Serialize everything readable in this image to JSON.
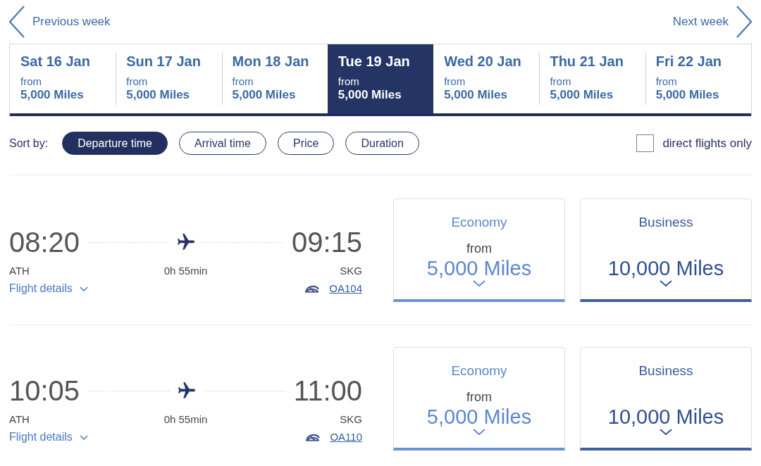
{
  "week_nav": {
    "previous": "Previous week",
    "next": "Next week"
  },
  "dates": [
    {
      "date": "Sat 16 Jan",
      "from": "from",
      "price": "5,000 Miles",
      "selected": false
    },
    {
      "date": "Sun 17 Jan",
      "from": "from",
      "price": "5,000 Miles",
      "selected": false
    },
    {
      "date": "Mon 18 Jan",
      "from": "from",
      "price": "5,000 Miles",
      "selected": false
    },
    {
      "date": "Tue 19 Jan",
      "from": "from",
      "price": "5,000 Miles",
      "selected": true
    },
    {
      "date": "Wed 20 Jan",
      "from": "from",
      "price": "5,000 Miles",
      "selected": false
    },
    {
      "date": "Thu 21 Jan",
      "from": "from",
      "price": "5,000 Miles",
      "selected": false
    },
    {
      "date": "Fri 22 Jan",
      "from": "from",
      "price": "5,000 Miles",
      "selected": false
    }
  ],
  "sort": {
    "label": "Sort by:",
    "options": [
      {
        "label": "Departure time",
        "selected": true
      },
      {
        "label": "Arrival time",
        "selected": false
      },
      {
        "label": "Price",
        "selected": false
      },
      {
        "label": "Duration",
        "selected": false
      }
    ]
  },
  "direct_only": {
    "label": "direct flights only",
    "checked": false
  },
  "flights": [
    {
      "departure_time": "08:20",
      "arrival_time": "09:15",
      "origin": "ATH",
      "destination": "SKG",
      "duration": "0h 55min",
      "details_link": "Flight details",
      "flight_number": "OA104",
      "fares": [
        {
          "kind": "economy",
          "cabin": "Economy",
          "from": "from",
          "price": "5,000 Miles"
        },
        {
          "kind": "business",
          "cabin": "Business",
          "price": "10,000 Miles"
        }
      ]
    },
    {
      "departure_time": "10:05",
      "arrival_time": "11:00",
      "origin": "ATH",
      "destination": "SKG",
      "duration": "0h 55min",
      "details_link": "Flight details",
      "flight_number": "OA110",
      "fares": [
        {
          "kind": "economy",
          "cabin": "Economy",
          "from": "from",
          "price": "5,000 Miles"
        },
        {
          "kind": "business",
          "cabin": "Business",
          "price": "10,000 Miles"
        }
      ]
    }
  ]
}
